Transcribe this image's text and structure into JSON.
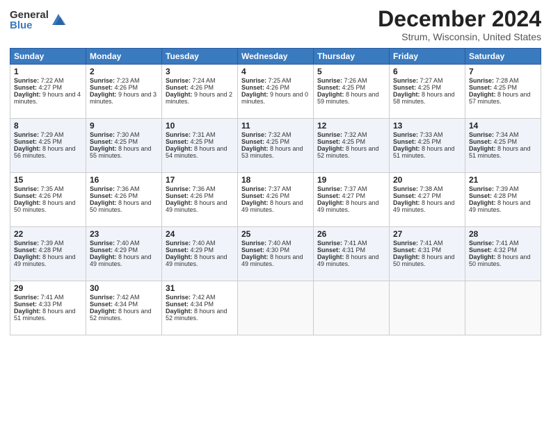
{
  "logo": {
    "general": "General",
    "blue": "Blue"
  },
  "header": {
    "month": "December 2024",
    "location": "Strum, Wisconsin, United States"
  },
  "weekdays": [
    "Sunday",
    "Monday",
    "Tuesday",
    "Wednesday",
    "Thursday",
    "Friday",
    "Saturday"
  ],
  "weeks": [
    [
      {
        "day": "1",
        "data": "Sunrise: 7:22 AM\nSunset: 4:27 PM\nDaylight: 9 hours and 4 minutes."
      },
      {
        "day": "2",
        "data": "Sunrise: 7:23 AM\nSunset: 4:26 PM\nDaylight: 9 hours and 3 minutes."
      },
      {
        "day": "3",
        "data": "Sunrise: 7:24 AM\nSunset: 4:26 PM\nDaylight: 9 hours and 2 minutes."
      },
      {
        "day": "4",
        "data": "Sunrise: 7:25 AM\nSunset: 4:26 PM\nDaylight: 9 hours and 0 minutes."
      },
      {
        "day": "5",
        "data": "Sunrise: 7:26 AM\nSunset: 4:25 PM\nDaylight: 8 hours and 59 minutes."
      },
      {
        "day": "6",
        "data": "Sunrise: 7:27 AM\nSunset: 4:25 PM\nDaylight: 8 hours and 58 minutes."
      },
      {
        "day": "7",
        "data": "Sunrise: 7:28 AM\nSunset: 4:25 PM\nDaylight: 8 hours and 57 minutes."
      }
    ],
    [
      {
        "day": "8",
        "data": "Sunrise: 7:29 AM\nSunset: 4:25 PM\nDaylight: 8 hours and 56 minutes."
      },
      {
        "day": "9",
        "data": "Sunrise: 7:30 AM\nSunset: 4:25 PM\nDaylight: 8 hours and 55 minutes."
      },
      {
        "day": "10",
        "data": "Sunrise: 7:31 AM\nSunset: 4:25 PM\nDaylight: 8 hours and 54 minutes."
      },
      {
        "day": "11",
        "data": "Sunrise: 7:32 AM\nSunset: 4:25 PM\nDaylight: 8 hours and 53 minutes."
      },
      {
        "day": "12",
        "data": "Sunrise: 7:32 AM\nSunset: 4:25 PM\nDaylight: 8 hours and 52 minutes."
      },
      {
        "day": "13",
        "data": "Sunrise: 7:33 AM\nSunset: 4:25 PM\nDaylight: 8 hours and 51 minutes."
      },
      {
        "day": "14",
        "data": "Sunrise: 7:34 AM\nSunset: 4:25 PM\nDaylight: 8 hours and 51 minutes."
      }
    ],
    [
      {
        "day": "15",
        "data": "Sunrise: 7:35 AM\nSunset: 4:26 PM\nDaylight: 8 hours and 50 minutes."
      },
      {
        "day": "16",
        "data": "Sunrise: 7:36 AM\nSunset: 4:26 PM\nDaylight: 8 hours and 50 minutes."
      },
      {
        "day": "17",
        "data": "Sunrise: 7:36 AM\nSunset: 4:26 PM\nDaylight: 8 hours and 49 minutes."
      },
      {
        "day": "18",
        "data": "Sunrise: 7:37 AM\nSunset: 4:26 PM\nDaylight: 8 hours and 49 minutes."
      },
      {
        "day": "19",
        "data": "Sunrise: 7:37 AM\nSunset: 4:27 PM\nDaylight: 8 hours and 49 minutes."
      },
      {
        "day": "20",
        "data": "Sunrise: 7:38 AM\nSunset: 4:27 PM\nDaylight: 8 hours and 49 minutes."
      },
      {
        "day": "21",
        "data": "Sunrise: 7:39 AM\nSunset: 4:28 PM\nDaylight: 8 hours and 49 minutes."
      }
    ],
    [
      {
        "day": "22",
        "data": "Sunrise: 7:39 AM\nSunset: 4:28 PM\nDaylight: 8 hours and 49 minutes."
      },
      {
        "day": "23",
        "data": "Sunrise: 7:40 AM\nSunset: 4:29 PM\nDaylight: 8 hours and 49 minutes."
      },
      {
        "day": "24",
        "data": "Sunrise: 7:40 AM\nSunset: 4:29 PM\nDaylight: 8 hours and 49 minutes."
      },
      {
        "day": "25",
        "data": "Sunrise: 7:40 AM\nSunset: 4:30 PM\nDaylight: 8 hours and 49 minutes."
      },
      {
        "day": "26",
        "data": "Sunrise: 7:41 AM\nSunset: 4:31 PM\nDaylight: 8 hours and 49 minutes."
      },
      {
        "day": "27",
        "data": "Sunrise: 7:41 AM\nSunset: 4:31 PM\nDaylight: 8 hours and 50 minutes."
      },
      {
        "day": "28",
        "data": "Sunrise: 7:41 AM\nSunset: 4:32 PM\nDaylight: 8 hours and 50 minutes."
      }
    ],
    [
      {
        "day": "29",
        "data": "Sunrise: 7:41 AM\nSunset: 4:33 PM\nDaylight: 8 hours and 51 minutes."
      },
      {
        "day": "30",
        "data": "Sunrise: 7:42 AM\nSunset: 4:34 PM\nDaylight: 8 hours and 52 minutes."
      },
      {
        "day": "31",
        "data": "Sunrise: 7:42 AM\nSunset: 4:34 PM\nDaylight: 8 hours and 52 minutes."
      },
      {
        "day": "",
        "data": ""
      },
      {
        "day": "",
        "data": ""
      },
      {
        "day": "",
        "data": ""
      },
      {
        "day": "",
        "data": ""
      }
    ]
  ]
}
